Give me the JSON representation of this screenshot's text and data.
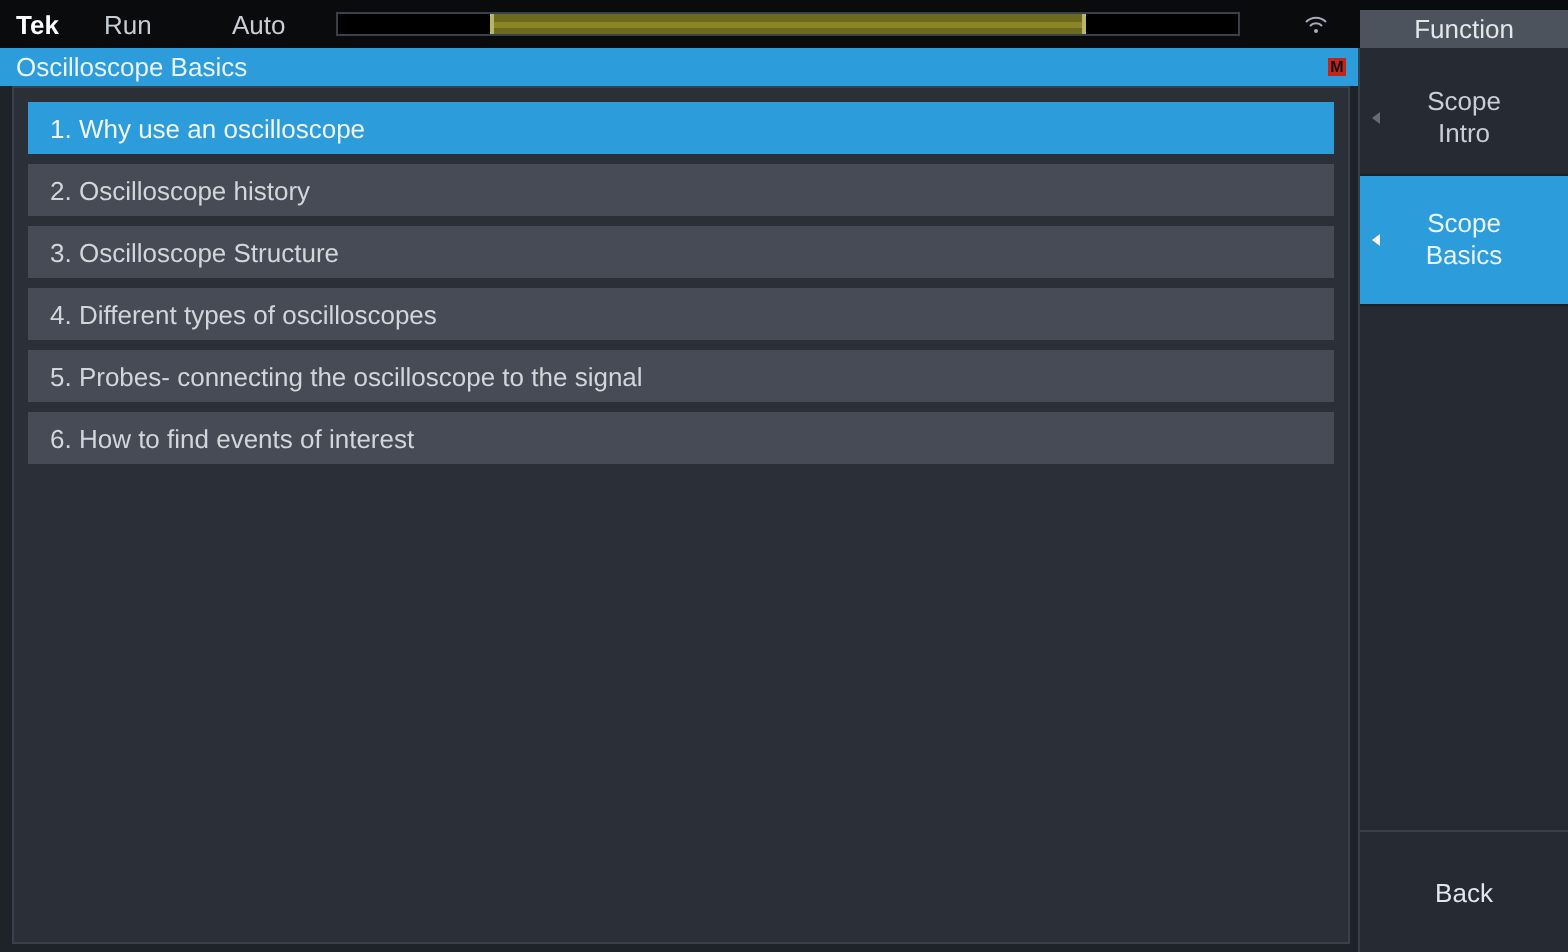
{
  "status_bar": {
    "brand": "Tek",
    "run_state": "Run",
    "trigger_mode": "Auto"
  },
  "header": {
    "title": "Oscilloscope Basics",
    "badge": "M"
  },
  "topics": [
    {
      "label": "1. Why use an oscilloscope",
      "selected": true
    },
    {
      "label": "2. Oscilloscope history",
      "selected": false
    },
    {
      "label": "3. Oscilloscope Structure",
      "selected": false
    },
    {
      "label": "4. Different types of oscilloscopes",
      "selected": false
    },
    {
      "label": "5. Probes- connecting the oscilloscope to the signal",
      "selected": false
    },
    {
      "label": "6. How to find events of interest",
      "selected": false
    }
  ],
  "side_menu": {
    "title": "Function",
    "items": [
      {
        "label": "Scope Intro",
        "selected": false
      },
      {
        "label": "Scope Basics",
        "selected": true
      }
    ],
    "back": "Back"
  }
}
